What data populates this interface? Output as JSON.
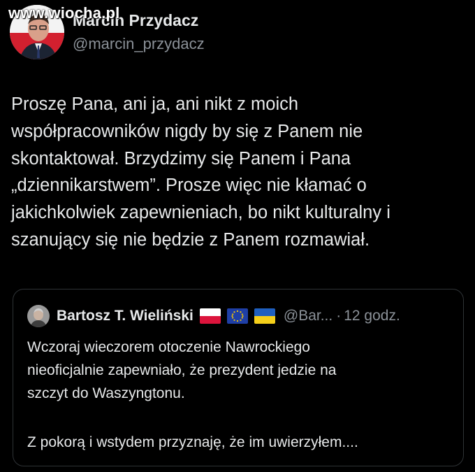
{
  "watermark": "www.wiocha.pl",
  "author": {
    "display_name": "Marcin Przydacz",
    "handle": "@marcin_przydacz",
    "avatar_icon": "profile-photo-icon"
  },
  "tweet": {
    "text": "Proszę Pana, ani ja, ani nikt z moich\nwspółpracowników nigdy by się z Panem nie\nskontaktował. Brzydzimy się Panem i Pana\n„dziennikarstwem”. Prosze więc nie kłamać o\njakichkolwiek zapewnieniach, bo nikt kulturalny i\nszanujący się nie będzie z Panem rozmawiał."
  },
  "quoted_tweet": {
    "display_name": "Bartosz T. Wieliński",
    "handle": "@Bar...",
    "separator": "·",
    "time": "12 godz.",
    "flags": [
      "flag-poland-icon",
      "flag-eu-icon",
      "flag-ukraine-icon"
    ],
    "text_paragraph_1": "Wczoraj wieczorem otoczenie Nawrockiego\nnieoficjalnie zapewniało, że prezydent jedzie na\nszczyt do Waszyngtonu.",
    "text_paragraph_2": "Z pokorą i wstydem przyznaję, że im uwierzyłem...."
  },
  "colors": {
    "background": "#000000",
    "text_primary": "#e7e9ea",
    "text_secondary": "#8b9198",
    "border": "#2f3336"
  }
}
